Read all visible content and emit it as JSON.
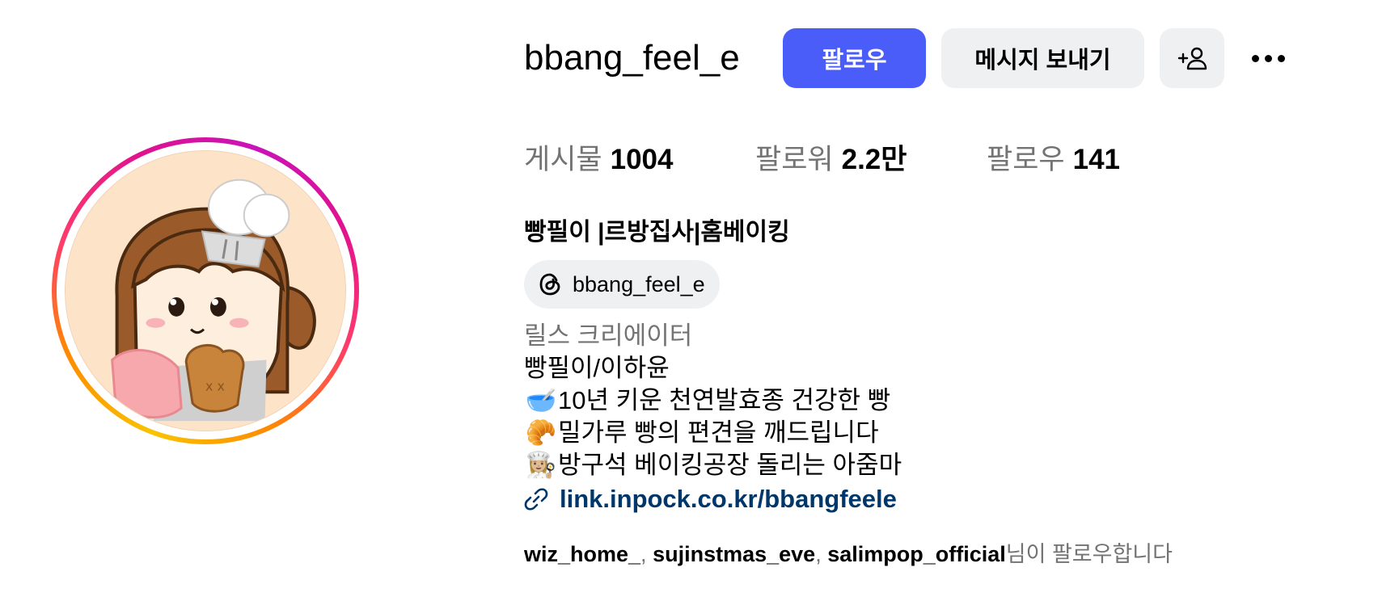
{
  "profile": {
    "username": "bbang_feel_e",
    "display_name": "빵필이 |르방집사|홈베이킹",
    "category": "릴스 크리에이터"
  },
  "actions": {
    "follow": "팔로우",
    "message": "메시지 보내기",
    "add_user_icon": "person-plus-icon",
    "more_icon": "ellipsis-icon"
  },
  "stats": [
    {
      "label": "게시물",
      "value": "1004"
    },
    {
      "label": "팔로워",
      "value": "2.2만"
    },
    {
      "label": "팔로우",
      "value": "141"
    }
  ],
  "threads": {
    "handle": "bbang_feel_e",
    "icon": "threads-icon"
  },
  "bio": {
    "line1": "빵필이/이하윤",
    "line2_emoji": "🥣",
    "line2": "10년 키운 천연발효종 건강한 빵",
    "line3_emoji": "🥐",
    "line3": "밀가루 빵의 편견을 깨드립니다",
    "line4_emoji": "👩🏼‍🍳",
    "line4": "방구석 베이킹공장 돌리는 아줌마"
  },
  "link": {
    "text": "link.inpock.co.kr/bbangfeele",
    "icon": "link-icon"
  },
  "followed_by": {
    "accounts": [
      "wiz_home_",
      "sujinstmas_eve",
      "salimpop_official"
    ],
    "separator": ", ",
    "suffix": "님이 팔로우합니다"
  },
  "colors": {
    "follow_button": "#4a5df9",
    "secondary_button": "#eff0f2",
    "link": "#00376b",
    "muted_text": "#737373"
  }
}
